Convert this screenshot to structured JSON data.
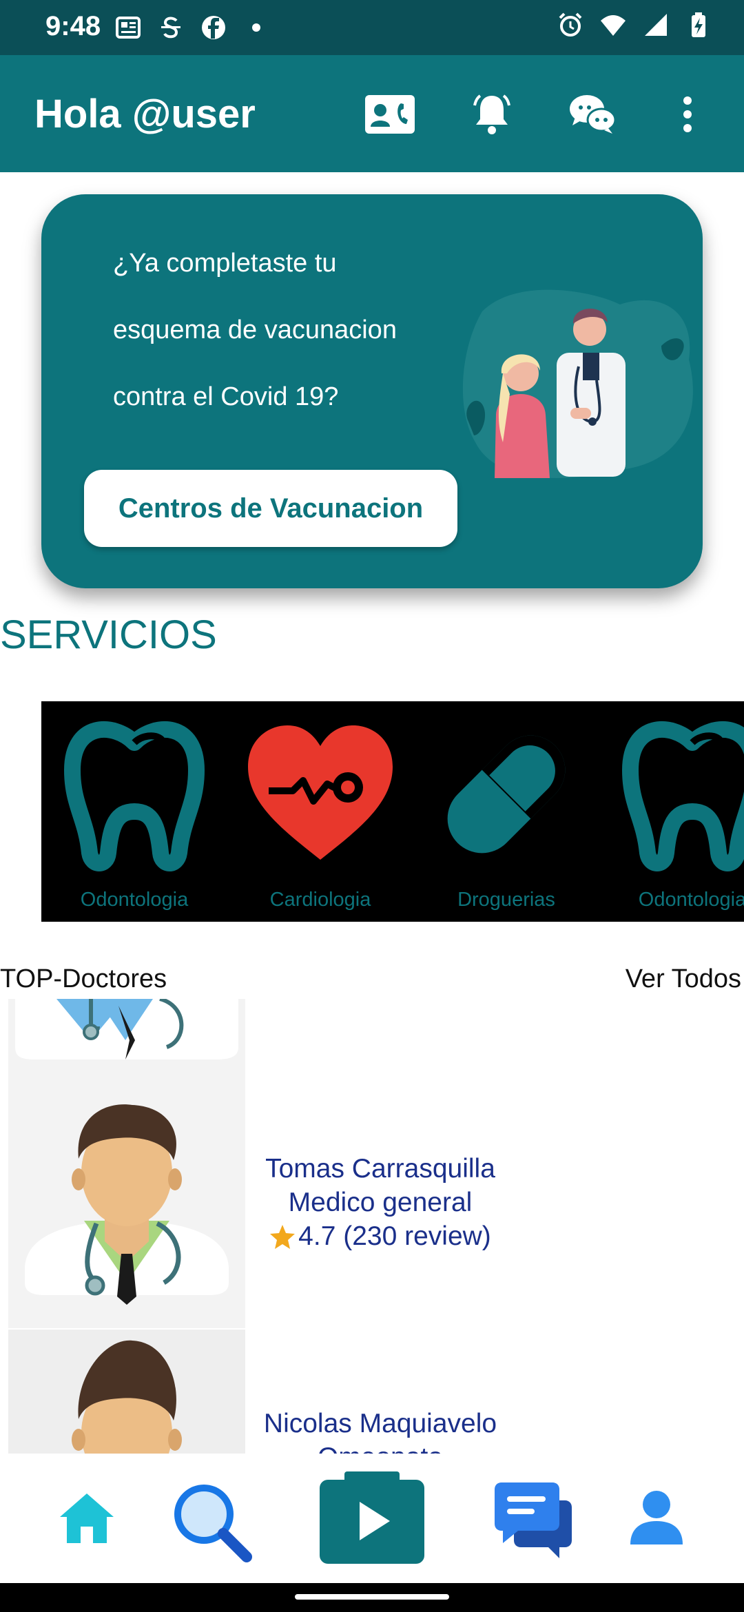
{
  "status_bar": {
    "time": "9:48",
    "left_icons": [
      "news-icon",
      "strikethrough-s-icon",
      "facebook-icon",
      "dot-icon"
    ],
    "right_icons": [
      "alarm-icon",
      "wifi-icon",
      "signal-icon",
      "battery-charging-icon"
    ]
  },
  "app_bar": {
    "title": "Hola @user",
    "actions": [
      "contact-card-icon",
      "bell-icon",
      "chat-icon",
      "more-vert-icon"
    ]
  },
  "banner": {
    "line1": "¿Ya completaste tu",
    "line2": "esquema de vacunacion",
    "line3": "contra el Covid 19?",
    "button_label": "Centros de Vacunacion"
  },
  "services_section": {
    "title": "SERVICIOS",
    "items": [
      {
        "label": "Odontologia",
        "icon": "tooth-icon"
      },
      {
        "label": "Cardiologia",
        "icon": "heart-pulse-icon"
      },
      {
        "label": "Droguerias",
        "icon": "pill-icon"
      },
      {
        "label": "Odontologia",
        "icon": "tooth-icon"
      }
    ]
  },
  "top_doctors": {
    "title": "TOP-Doctores",
    "see_all": "Ver Todos",
    "doctors": [
      {
        "name": "Tomas Carrasquilla",
        "specialty": "Medico general",
        "rating": "4.7 (230 review)"
      },
      {
        "name": "Nicolas Maquiavelo",
        "specialty": "Omeopata"
      }
    ]
  },
  "bottom_nav": {
    "items": [
      "home-icon",
      "search-icon",
      "video-play-icon",
      "messages-icon",
      "profile-icon"
    ]
  },
  "colors": {
    "primary": "#0d747c",
    "status_bar": "#0b4f57",
    "doctor_text": "#1a2f8a",
    "heart": "#e8372c"
  }
}
